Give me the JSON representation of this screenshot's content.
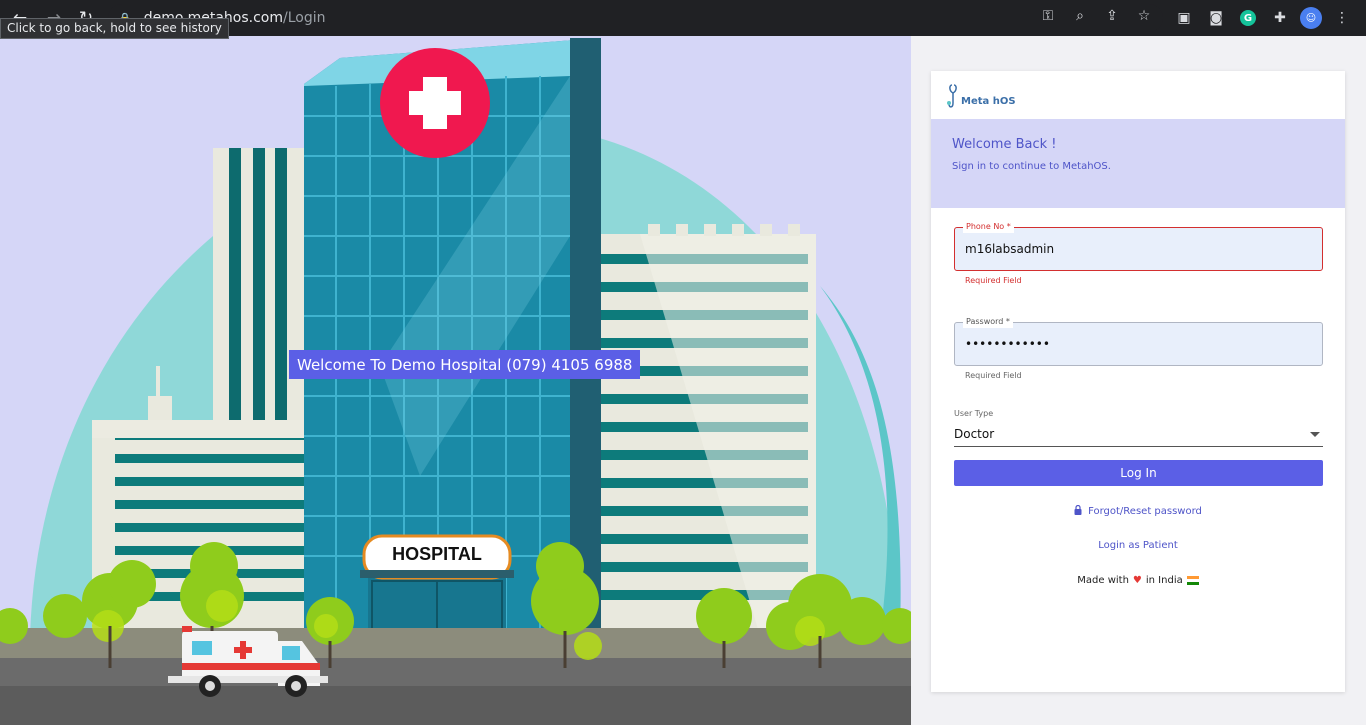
{
  "browser": {
    "url_host": "demo.metahos.com",
    "url_path": "/Login",
    "tooltip": "Click to go back, hold to see history",
    "grammarly_letter": "G"
  },
  "illustration": {
    "banner": "Welcome To Demo Hospital (079) 4105 6988",
    "sign": "HOSPITAL"
  },
  "card": {
    "logo_text": "Meta hOS",
    "welcome_title": "Welcome Back !",
    "welcome_sub": "Sign in to continue to MetahOS.",
    "phone": {
      "label": "Phone No *",
      "value": "m16labsadmin",
      "helper": "Required Field"
    },
    "password": {
      "label": "Password *",
      "value": "••••••••••••",
      "helper": "Required Field"
    },
    "user_type": {
      "label": "User Type",
      "value": "Doctor"
    },
    "login_label": "Log In",
    "forgot_label": "Forgot/Reset password",
    "patient_label": "Login as Patient",
    "made_prefix": "Made with",
    "made_suffix": "in India"
  },
  "colors": {
    "accent": "#5b5fe6",
    "error": "#d32f2f",
    "panel": "#d5d6f7"
  }
}
